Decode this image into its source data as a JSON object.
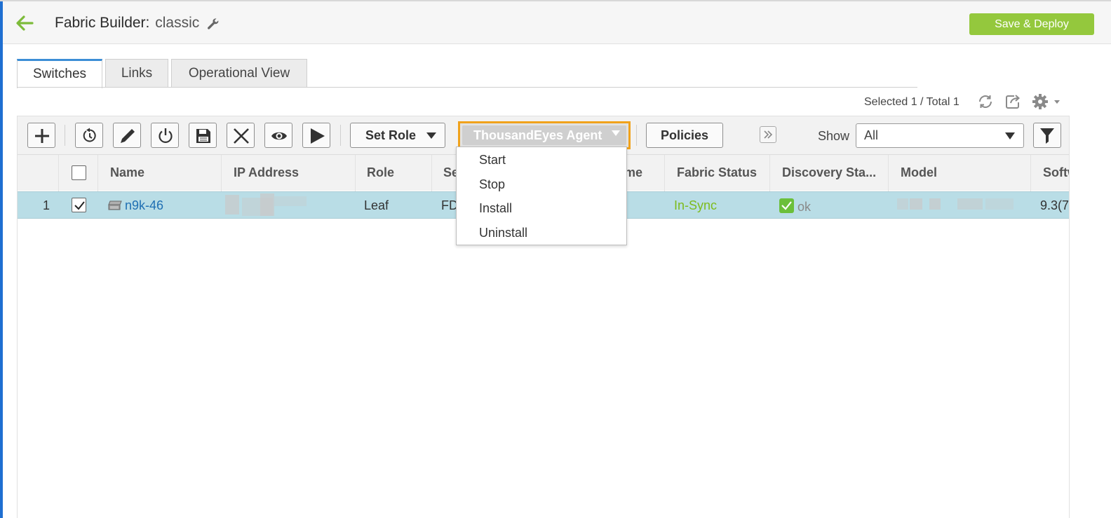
{
  "header": {
    "title_prefix": "Fabric Builder:",
    "fabric_name": "classic",
    "save_deploy_label": "Save & Deploy"
  },
  "tabs": [
    {
      "label": "Switches",
      "active": true
    },
    {
      "label": "Links",
      "active": false
    },
    {
      "label": "Operational View",
      "active": false
    }
  ],
  "selection": {
    "text": "Selected 1 / Total 1"
  },
  "toolbar": {
    "set_role_label": "Set Role",
    "thousandeyes_label": "ThousandEyes Agent",
    "policies_label": "Policies",
    "show_label": "Show",
    "show_value": "All"
  },
  "dropdown": {
    "items": [
      "Start",
      "Stop",
      "Install",
      "Uninstall"
    ]
  },
  "table": {
    "columns": [
      "Name",
      "IP Address",
      "Role",
      "Se",
      "me",
      "Fabric Status",
      "Discovery Sta...",
      "Model",
      "Softw"
    ],
    "rows": [
      {
        "index": "1",
        "checked": true,
        "name": "n9k-46",
        "role": "Leaf",
        "serial": "FD",
        "fabric_status": "In-Sync",
        "discovery_status": "ok",
        "software": "9.3(7"
      }
    ]
  },
  "colors": {
    "accent_green": "#94c83d",
    "in_sync": "#7dbb1d",
    "highlight_orange": "#f0a21c",
    "selected_row": "#b9dde6",
    "link_blue": "#1f6fb3"
  }
}
